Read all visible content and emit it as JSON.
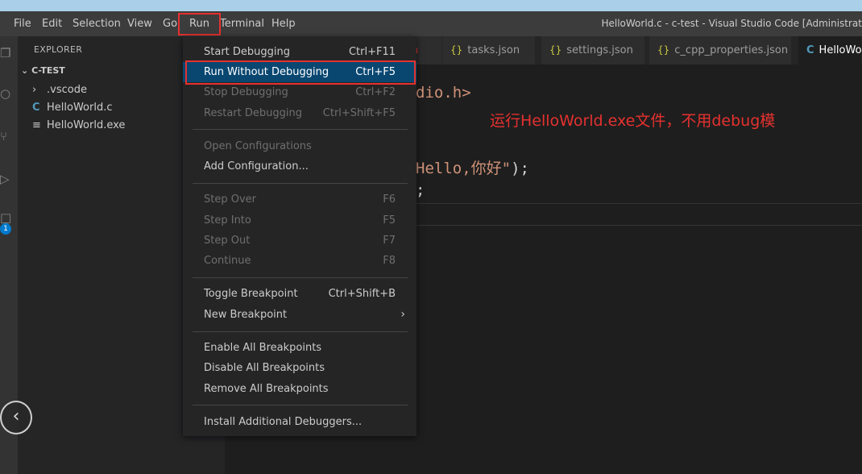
{
  "menubar": {
    "items": [
      "File",
      "Edit",
      "Selection",
      "View",
      "Go",
      "Run",
      "Terminal",
      "Help"
    ],
    "window_title": "HelloWorld.c - c-test - Visual Studio Code [Administrat"
  },
  "sidebar": {
    "title": "EXPLORER",
    "folder": "C-TEST",
    "items": [
      ".vscode",
      "HelloWorld.c",
      "HelloWorld.exe"
    ]
  },
  "tabs": {
    "items": [
      "tasks.json",
      "settings.json",
      "c_cpp_properties.json",
      "HelloWor"
    ],
    "partial_first": "n"
  },
  "editor": {
    "line1": "dio.h>",
    "line2_pre": "Hello,你好\"",
    "line2_post": ");",
    "line3": ";",
    "annotation": "运行HelloWorld.exe文件，不用debug模"
  },
  "run_menu": {
    "items": [
      {
        "label": "Start Debugging",
        "key": "Ctrl+F11"
      },
      {
        "label": "Run Without Debugging",
        "key": "Ctrl+F5"
      },
      {
        "label": "Stop Debugging",
        "key": "Ctrl+F2"
      },
      {
        "label": "Restart Debugging",
        "key": "Ctrl+Shift+F5"
      },
      {
        "label": "Open Configurations",
        "key": ""
      },
      {
        "label": "Add Configuration...",
        "key": ""
      },
      {
        "label": "Step Over",
        "key": "F6"
      },
      {
        "label": "Step Into",
        "key": "F5"
      },
      {
        "label": "Step Out",
        "key": "F7"
      },
      {
        "label": "Continue",
        "key": "F8"
      },
      {
        "label": "Toggle Breakpoint",
        "key": "Ctrl+Shift+B"
      },
      {
        "label": "New Breakpoint",
        "key": ""
      },
      {
        "label": "Enable All Breakpoints",
        "key": ""
      },
      {
        "label": "Disable All Breakpoints",
        "key": ""
      },
      {
        "label": "Remove All Breakpoints",
        "key": ""
      },
      {
        "label": "Install Additional Debuggers...",
        "key": ""
      }
    ]
  },
  "activity": {
    "badge": "1"
  },
  "colors": {
    "accent_red": "#e5312f",
    "highlight": "#094771",
    "string": "#ce9178",
    "badge": "#007acc"
  }
}
